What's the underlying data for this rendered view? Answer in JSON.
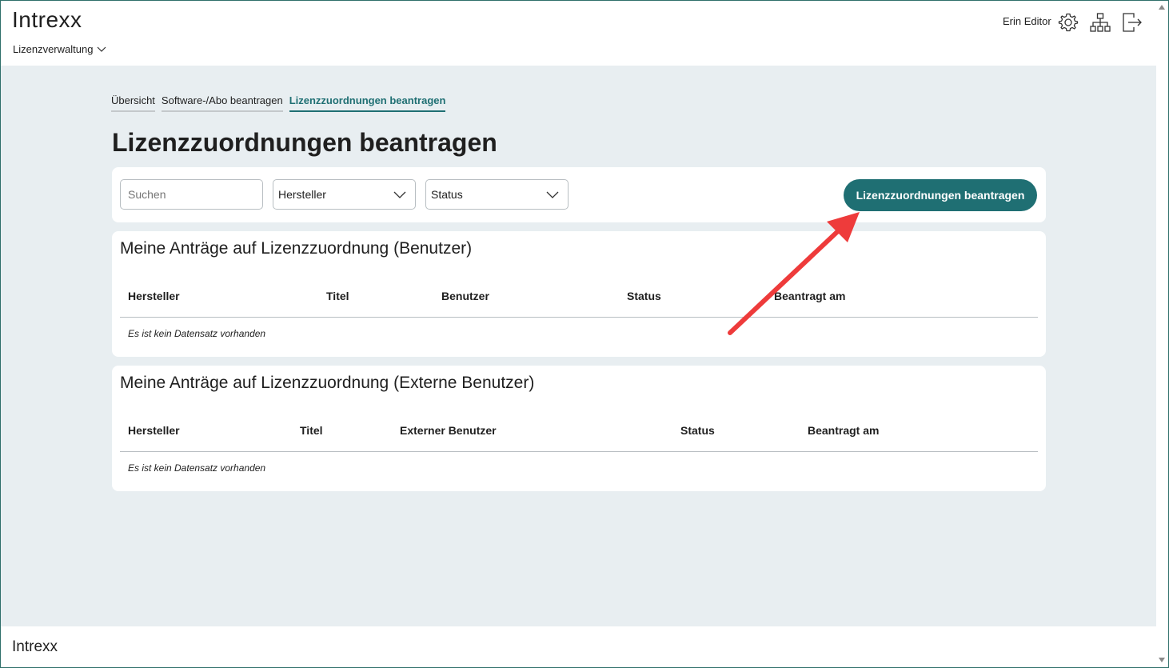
{
  "header": {
    "logo": "Intrexx",
    "app_menu_label": "Lizenzverwaltung",
    "user_name": "Erin Editor",
    "icons": [
      "gear-icon",
      "sitemap-icon",
      "logout-icon"
    ]
  },
  "tabs": [
    {
      "label": "Übersicht",
      "active": false
    },
    {
      "label": "Software-/Abo beantragen",
      "active": false
    },
    {
      "label": "Lizenzzuordnungen beantragen",
      "active": true
    }
  ],
  "page_title": "Lizenzzuordnungen beantragen",
  "filters": {
    "search_placeholder": "Suchen",
    "manufacturer_value": "Hersteller",
    "status_value": "Status",
    "action_button": "Lizenzzuordnungen beantragen"
  },
  "tables": [
    {
      "title": "Meine Anträge auf Lizenzzuordnung (Benutzer)",
      "columns": [
        "Hersteller",
        "Titel",
        "Benutzer",
        "Status",
        "Beantragt am"
      ],
      "empty_text": "Es ist kein Datensatz vorhanden"
    },
    {
      "title": "Meine Anträge auf Lizenzzuordnung (Externe Benutzer)",
      "columns": [
        "Hersteller",
        "Titel",
        "Externer Benutzer",
        "Status",
        "Beantragt am"
      ],
      "empty_text": "Es ist kein Datensatz vorhanden"
    }
  ],
  "footer": {
    "logo": "Intrexx"
  },
  "colors": {
    "accent": "#1f6f73",
    "background": "#e8eef1",
    "annotation": "#ee3b3b"
  }
}
